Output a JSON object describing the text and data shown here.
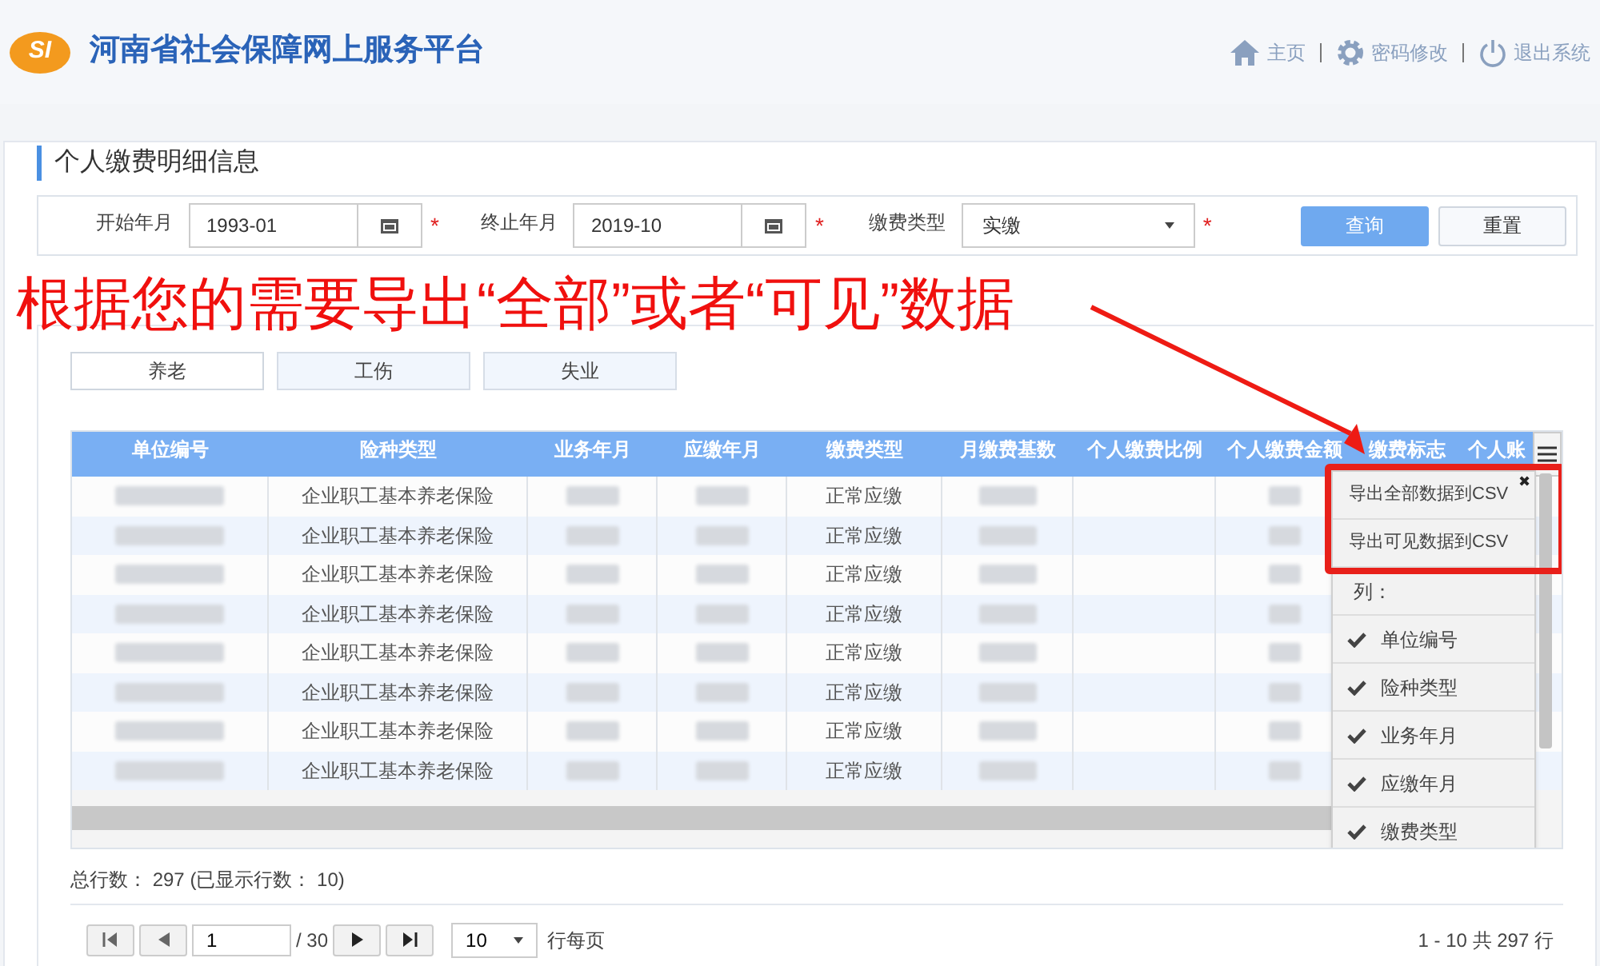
{
  "header": {
    "logo_text": "SI",
    "title": "河南省社会保障网上服务平台",
    "nav": [
      {
        "kind": "home",
        "label": "主页"
      },
      {
        "kind": "settings",
        "label": "密码修改"
      },
      {
        "kind": "power",
        "label": "退出系统"
      }
    ]
  },
  "section_title": "个人缴费明细信息",
  "filters": [
    {
      "kind": "date",
      "label": "开始年月",
      "value": "1993-01",
      "required_mark": "*"
    },
    {
      "kind": "date",
      "label": "终止年月",
      "value": "2019-10",
      "required_mark": "*"
    },
    {
      "kind": "select",
      "label": "缴费类型",
      "value": "实缴",
      "required_mark": "*"
    }
  ],
  "buttons": [
    {
      "label": "查询",
      "primary": true
    },
    {
      "label": "重置",
      "primary": false
    }
  ],
  "annotation": "根据您的需要导出“全部”或者“可见”数据",
  "tabs": [
    {
      "label": "养老",
      "selected": true
    },
    {
      "label": "工伤",
      "selected": false
    },
    {
      "label": "失业",
      "selected": false
    }
  ],
  "table": {
    "columns": [
      {
        "label": "单位编号",
        "redacted": true
      },
      {
        "label": "险种类型",
        "redacted": false
      },
      {
        "label": "业务年月",
        "redacted": true
      },
      {
        "label": "应缴年月",
        "redacted": true
      },
      {
        "label": "缴费类型",
        "redacted": false
      },
      {
        "label": "月缴费基数",
        "redacted": true
      },
      {
        "label": "个人缴费比例",
        "redacted": false
      },
      {
        "label": "个人缴费金额",
        "redacted": true
      },
      {
        "label": "缴费标志"
      },
      {
        "label": "个人账"
      }
    ],
    "rows": [
      {
        "cells": [
          null,
          "企业职工基本养老保险",
          null,
          null,
          "正常应缴",
          null,
          null,
          null,
          null,
          null
        ]
      },
      {
        "cells": [
          null,
          "企业职工基本养老保险",
          null,
          null,
          "正常应缴",
          null,
          null,
          null,
          null,
          null
        ]
      },
      {
        "cells": [
          null,
          "企业职工基本养老保险",
          null,
          null,
          "正常应缴",
          null,
          null,
          null,
          null,
          null
        ]
      },
      {
        "cells": [
          null,
          "企业职工基本养老保险",
          null,
          null,
          "正常应缴",
          null,
          null,
          null,
          null,
          null
        ]
      },
      {
        "cells": [
          null,
          "企业职工基本养老保险",
          null,
          null,
          "正常应缴",
          null,
          null,
          null,
          null,
          null
        ]
      },
      {
        "cells": [
          null,
          "企业职工基本养老保险",
          null,
          null,
          "正常应缴",
          null,
          null,
          null,
          null,
          null
        ]
      },
      {
        "cells": [
          null,
          "企业职工基本养老保险",
          null,
          null,
          "正常应缴",
          null,
          null,
          null,
          null,
          null
        ]
      },
      {
        "cells": [
          null,
          "企业职工基本养老保险",
          null,
          null,
          "正常应缴",
          null,
          null,
          null,
          null,
          null
        ]
      }
    ]
  },
  "column_menu": {
    "close": "✖",
    "export_items": [
      "导出全部数据到CSV",
      "导出可见数据到CSV"
    ],
    "columns_heading": "列：",
    "columns": [
      {
        "label": "单位编号",
        "checked": true
      },
      {
        "label": "险种类型",
        "checked": true
      },
      {
        "label": "业务年月",
        "checked": true
      },
      {
        "label": "应缴年月",
        "checked": true
      },
      {
        "label": "缴费类型",
        "checked": true
      }
    ]
  },
  "summary": "总行数： 297 (已显示行数： 10)",
  "pagination": {
    "page": "1",
    "of": "/ 30",
    "page_size": "10",
    "page_size_label": "行每页",
    "range": "1 - 10 共 297 行"
  }
}
